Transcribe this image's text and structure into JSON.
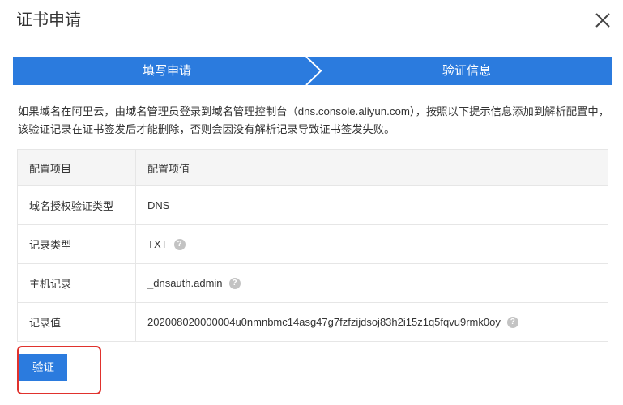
{
  "dialog": {
    "title": "证书申请",
    "close_icon": "close-icon"
  },
  "steps": [
    {
      "label": "填写申请",
      "state": "done"
    },
    {
      "label": "验证信息",
      "state": "active"
    }
  ],
  "colors": {
    "primary": "#2b7bde",
    "step_bar": "#2b7bde",
    "highlight": "#e0322d",
    "help_icon": "#c3c3c3"
  },
  "notice": "如果域名在阿里云，由域名管理员登录到域名管理控制台（dns.console.aliyun.com），按照以下提示信息添加到解析配置中，该验证记录在证书签发后才能删除，否则会因没有解析记录导致证书签发失败。",
  "table": {
    "headers": [
      "配置项目",
      "配置项值"
    ],
    "rows": [
      {
        "label": "域名授权验证类型",
        "value": "DNS",
        "help": false
      },
      {
        "label": "记录类型",
        "value": "TXT",
        "help": true
      },
      {
        "label": "主机记录",
        "value": "_dnsauth.admin",
        "help": true
      },
      {
        "label": "记录值",
        "value": "202008020000004u0nmnbmc14asg47g7fzfzijdsoj83h2i15z1q5fqvu9rmk0oy",
        "help": true
      }
    ]
  },
  "actions": {
    "verify_label": "验证"
  }
}
